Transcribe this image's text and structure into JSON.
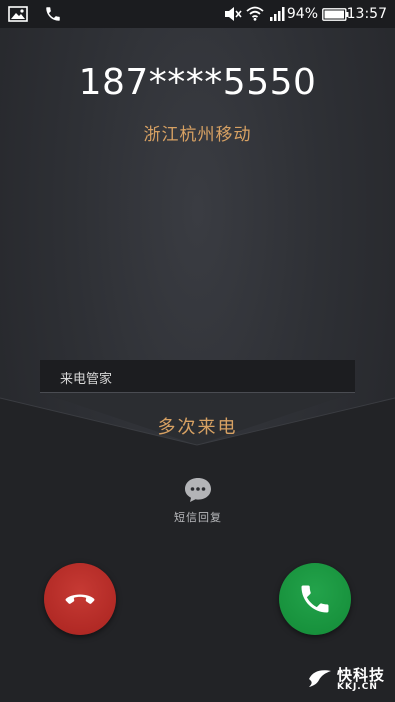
{
  "status_bar": {
    "left_icons": [
      "picture-icon",
      "phone-icon"
    ],
    "right_icons": [
      "mute-icon",
      "wifi-icon",
      "signal-icon",
      "battery-icon"
    ],
    "battery_percent": "94%",
    "time": "13:57"
  },
  "caller": {
    "number": "187****5550",
    "location": "浙江杭州移动"
  },
  "call_manager": {
    "label": "来电管家",
    "tag": "多次来电"
  },
  "sms_reply": {
    "icon": "chat-bubble-icon",
    "label": "短信回复"
  },
  "actions": {
    "decline_icon": "hang-up-icon",
    "accept_icon": "phone-icon"
  },
  "colors": {
    "location_text": "#d7a163",
    "tag_text": "#d7a163",
    "decline": "#b02a25",
    "accept": "#1a9940",
    "background": "#2e3035"
  },
  "watermark": {
    "text": "快科技",
    "sub": "KKJ.CN"
  }
}
